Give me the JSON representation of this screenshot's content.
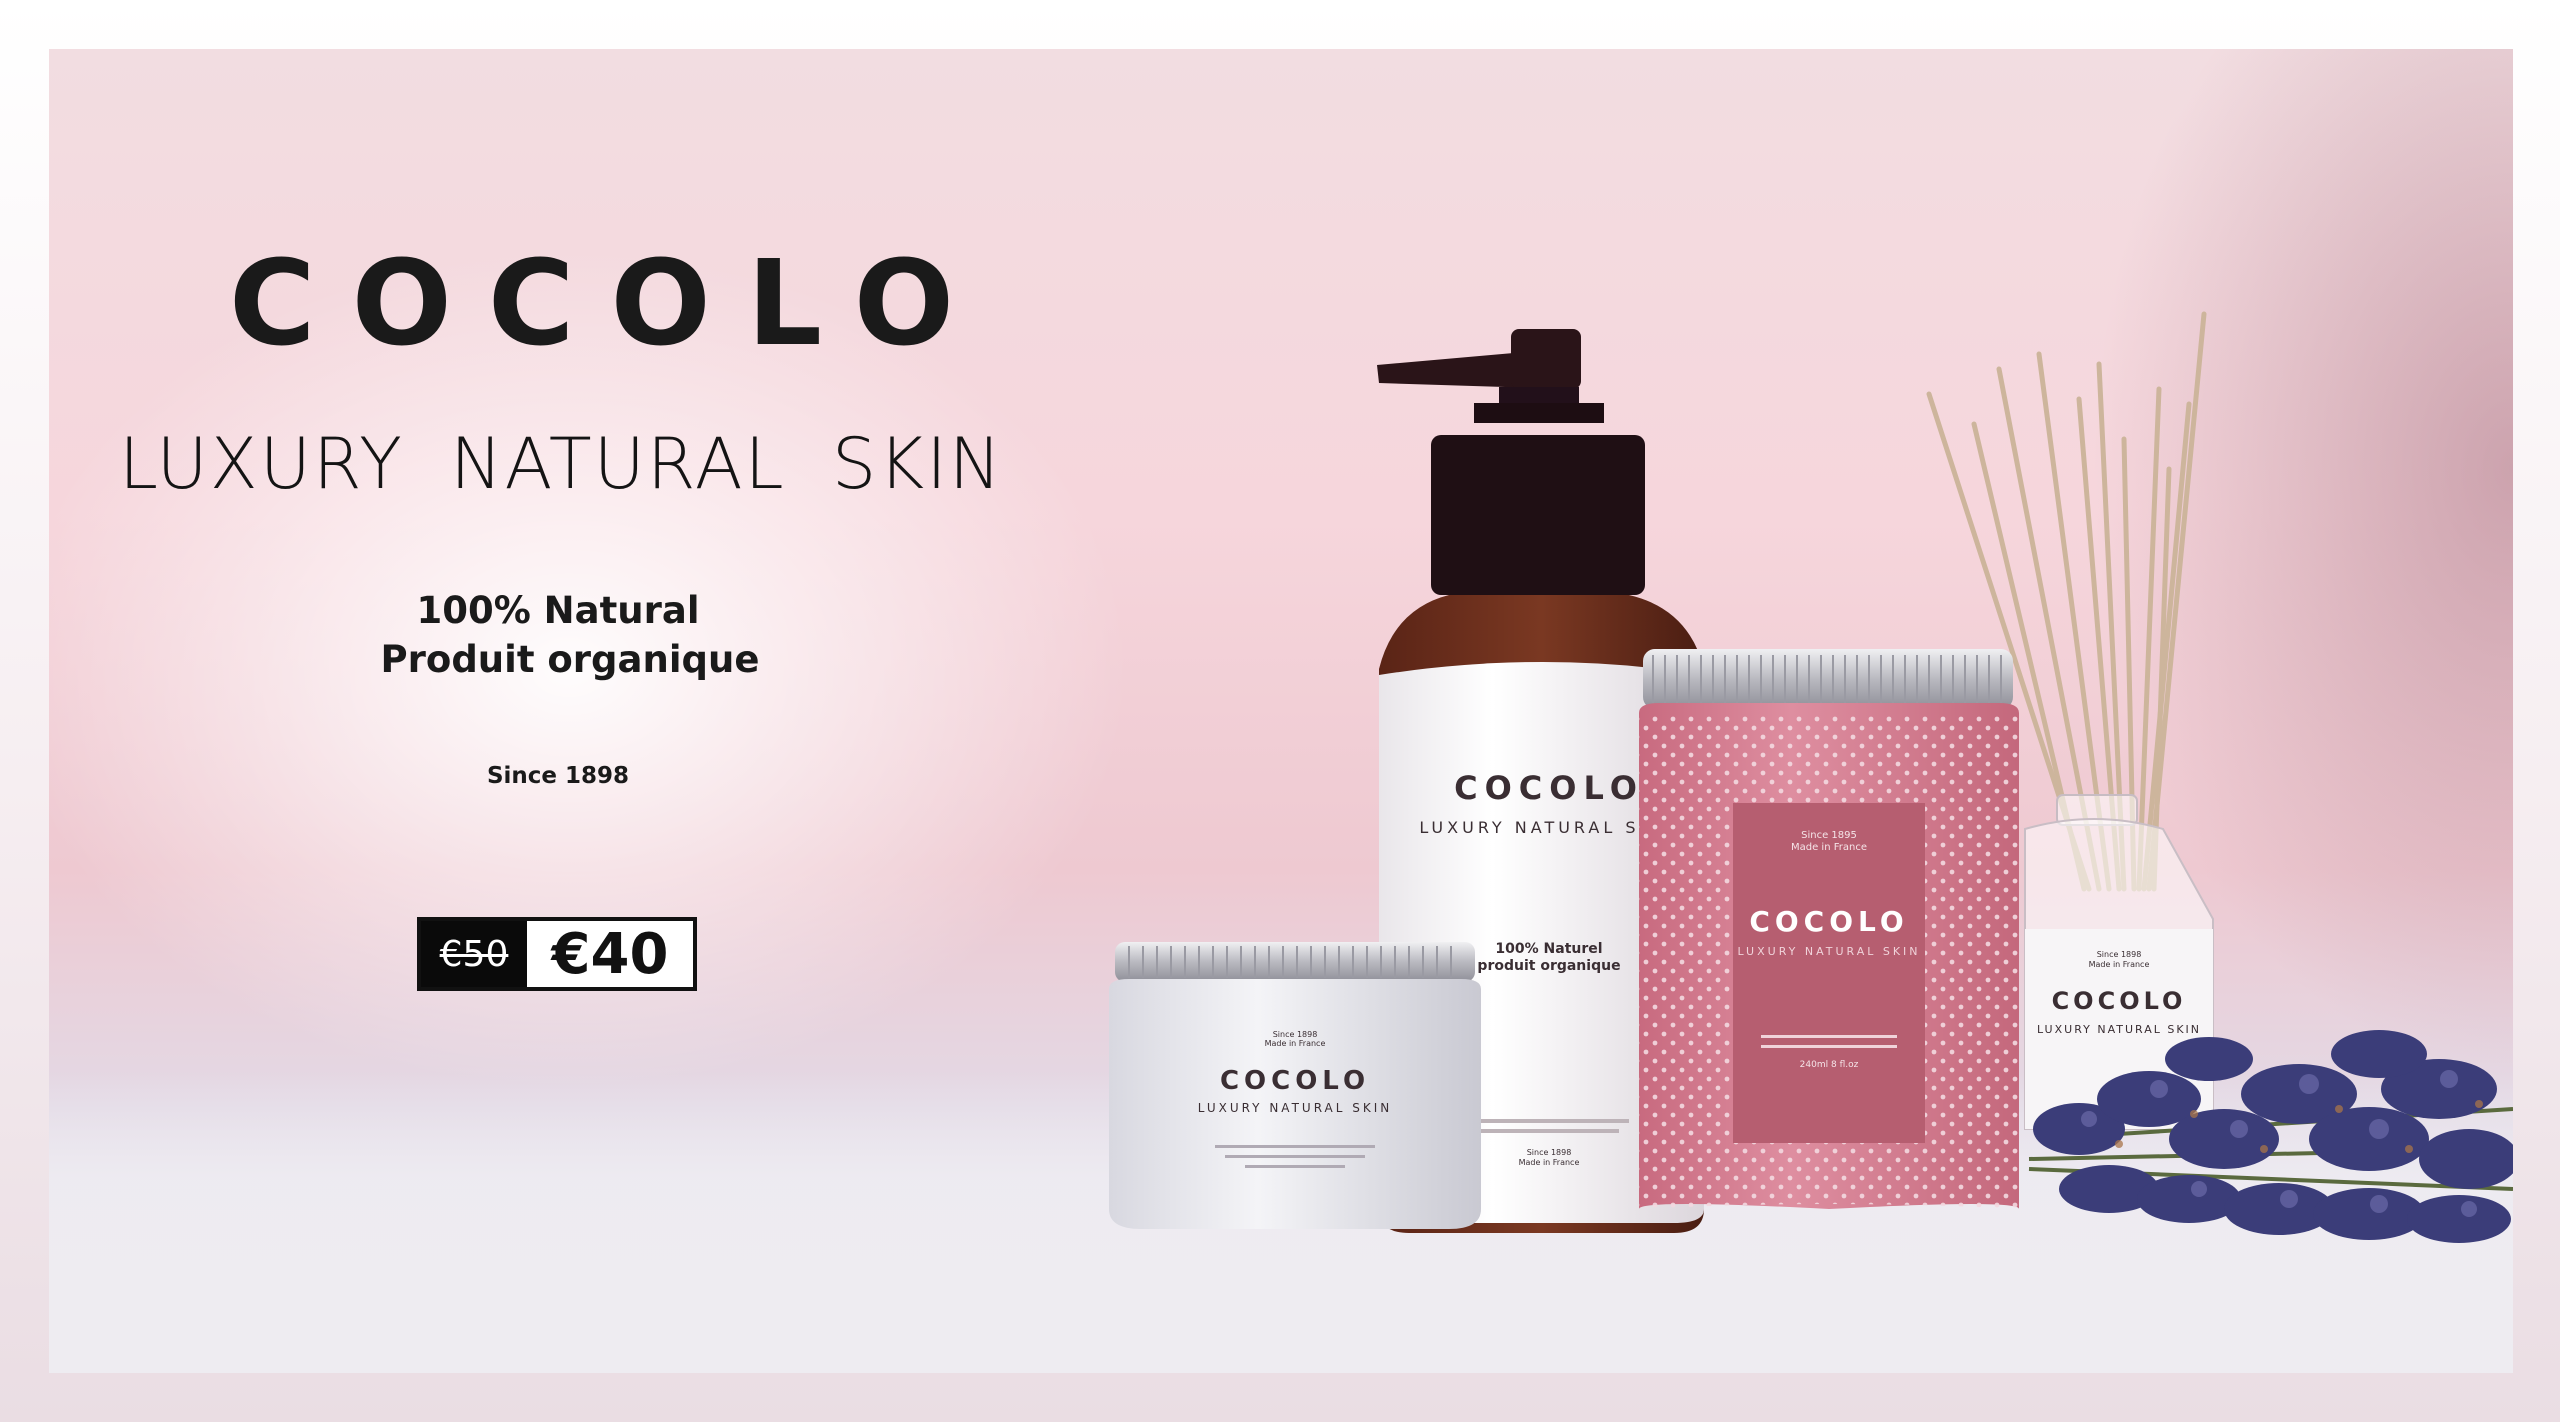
{
  "brand": {
    "logo": "COCOLO",
    "tagline": "LUXURY NATURAL SKIN"
  },
  "claims": {
    "line1": "100% Natural",
    "line2": "Produit organique",
    "since": "Since 1898"
  },
  "price": {
    "old": "€50",
    "new": "€40"
  },
  "products": {
    "bottle": {
      "brand": "COCOLO",
      "sub": "LUXURY NATURAL SKIN",
      "claim1": "100% Naturel",
      "claim2": "produit organique",
      "since": "Since 1898",
      "origin": "Made in France"
    },
    "pink_jar": {
      "since": "Since 1895",
      "origin": "Made in France",
      "brand": "COCOLO",
      "sub": "LUXURY NATURAL SKIN",
      "volume": "240ml 8 fl.oz"
    },
    "small_jar": {
      "since": "Since 1898",
      "origin": "Made in France",
      "brand": "COCOLO",
      "sub": "LUXURY NATURAL SKIN"
    },
    "diffuser": {
      "since": "Since 1898",
      "origin": "Made in France",
      "brand": "COCOLO",
      "sub": "LUXURY NATURAL SKIN"
    }
  },
  "colors": {
    "background_pink": "#f6d6dc",
    "jar_pink": "#d77f93",
    "label_pink": "#b9606f",
    "lavender": "#3d3f7a",
    "text_dark": "#141414"
  }
}
